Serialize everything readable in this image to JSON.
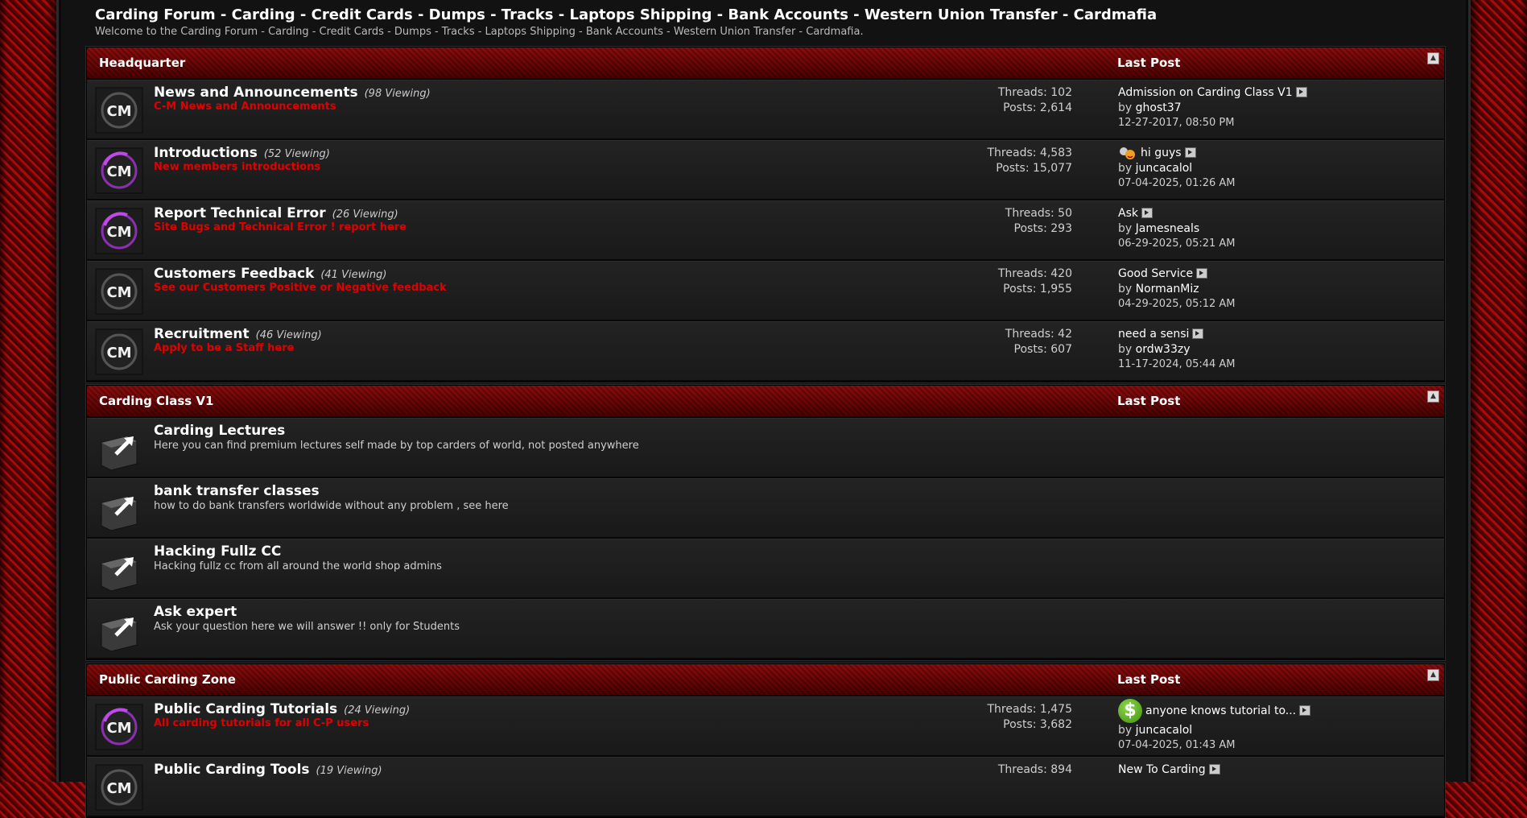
{
  "site": {
    "title": "Carding Forum - Carding - Credit Cards - Dumps - Tracks - Laptops Shipping - Bank Accounts - Western Union Transfer - Cardmafia",
    "welcome": "Welcome to the Carding Forum - Carding - Credit Cards - Dumps - Tracks - Laptops Shipping - Bank Accounts - Western Union Transfer - Cardmafia."
  },
  "categories": [
    {
      "title": "Headquarter",
      "last_post_header": "Last Post",
      "collapse_icon": "collapse-icon",
      "forums": [
        {
          "title": "News and Announcements",
          "viewing": "(98 Viewing)",
          "description": "C-M News and Announcements",
          "threads": "Threads: 102",
          "posts": "Posts: 2,614",
          "last_title": "Admission on Carding Class V1",
          "last_by": "by",
          "last_user": "ghost37",
          "last_date": "12-27-2017, 08:50 PM",
          "icon": "cm-logo-icon"
        },
        {
          "title": "Introductions",
          "viewing": "(52 Viewing)",
          "description": "New members introductions",
          "threads": "Threads: 4,583",
          "posts": "Posts: 15,077",
          "last_title": "hi guys",
          "last_by": "by",
          "last_user": "juncacalol",
          "last_date": "07-04-2025, 01:26 AM",
          "icon": "cm-logo-new-icon"
        },
        {
          "title": "Report Technical Error",
          "viewing": "(26 Viewing)",
          "description": "Site Bugs and Technical Error ! report here",
          "threads": "Threads: 50",
          "posts": "Posts: 293",
          "last_title": "Ask",
          "last_by": "by",
          "last_user": "Jamesneals",
          "last_date": "06-29-2025, 05:21 AM",
          "icon": "cm-logo-new-icon"
        },
        {
          "title": "Customers Feedback",
          "viewing": "(41 Viewing)",
          "description": "See our Customers Positive or Negative feedback",
          "threads": "Threads: 420",
          "posts": "Posts: 1,955",
          "last_title": "Good Service",
          "last_by": "by",
          "last_user": "NormanMiz",
          "last_date": "04-29-2025, 05:12 AM",
          "icon": "cm-logo-icon"
        },
        {
          "title": "Recruitment",
          "viewing": "(46 Viewing)",
          "description": "Apply to be a Staff here",
          "threads": "Threads: 42",
          "posts": "Posts: 607",
          "last_title": "need a sensi",
          "last_by": "by",
          "last_user": "ordw33zy",
          "last_date": "11-17-2024, 05:44 AM",
          "icon": "cm-logo-icon"
        }
      ]
    },
    {
      "title": "Carding Class V1",
      "last_post_header": "Last Post",
      "forums": [
        {
          "title": "Carding Lectures",
          "description": "Here you can find premium lectures self made by top carders of world, not posted anywhere",
          "icon": "folder-link-icon"
        },
        {
          "title": "bank transfer classes",
          "description": "how to do bank transfers worldwide without any problem , see here",
          "icon": "folder-link-icon"
        },
        {
          "title": "Hacking Fullz CC",
          "description": "Hacking fullz cc from all around the world shop admins",
          "icon": "folder-link-icon"
        },
        {
          "title": "Ask expert",
          "description": "Ask your question here we will answer !! only for Students",
          "icon": "folder-link-icon"
        }
      ]
    },
    {
      "title": "Public Carding Zone",
      "last_post_header": "Last Post",
      "forums": [
        {
          "title": "Public Carding Tutorials",
          "viewing": "(24 Viewing)",
          "description": "All carding tutorials for all C-P users",
          "threads": "Threads: 1,475",
          "posts": "Posts: 3,682",
          "last_title": "anyone knows tutorial to...",
          "last_by": "by",
          "last_user": "juncacalol",
          "last_date": "07-04-2025, 01:43 AM",
          "icon": "cm-logo-new-icon"
        },
        {
          "title": "Public Carding Tools",
          "viewing": "(19 Viewing)",
          "threads": "Threads: 894",
          "last_title": "New To Carding",
          "icon": "cm-logo-icon"
        }
      ]
    }
  ],
  "colors": {
    "accent_red": "#e00000",
    "header_red": "#8c0d0d",
    "background": "#121212"
  }
}
